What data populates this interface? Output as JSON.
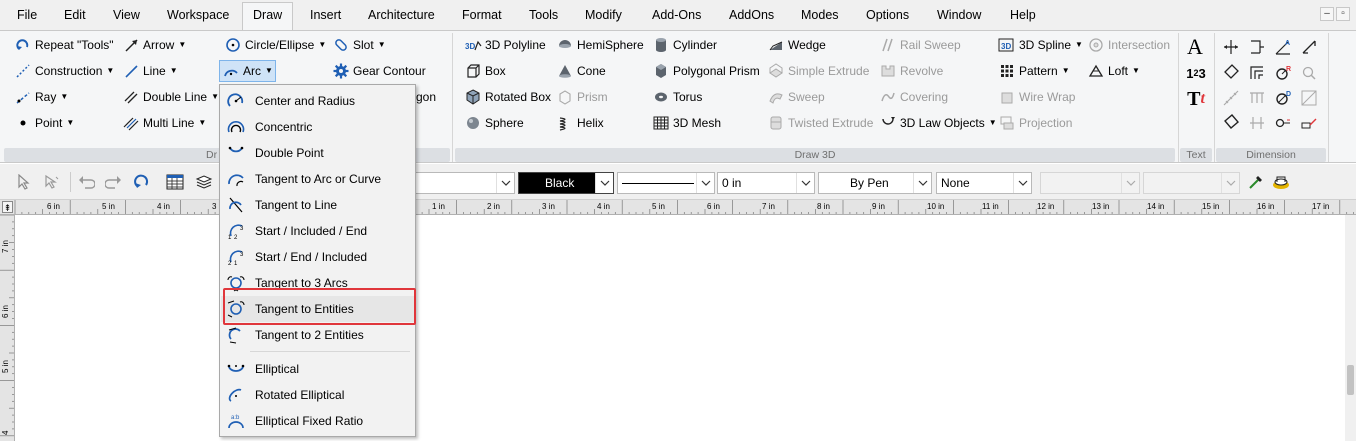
{
  "menubar": {
    "items": [
      "File",
      "Edit",
      "View",
      "Workspace",
      "Draw",
      "Insert",
      "Architecture",
      "Format",
      "Tools",
      "Modify",
      "Add-Ons",
      "AddOns",
      "Modes",
      "Options",
      "Window",
      "Help"
    ],
    "active": "Draw"
  },
  "ribbon": {
    "draw_col1": [
      "Repeat \"Tools\"",
      "Construction",
      "Ray",
      "Point"
    ],
    "draw_col2": [
      "Arrow",
      "Line",
      "Double Line",
      "Multi Line"
    ],
    "draw_col3": [
      "Circle/Ellipse",
      "Arc"
    ],
    "draw_col4": [
      "Slot",
      "Gear Contour",
      "ygon"
    ],
    "draw_group_label": "Dr",
    "d3_col1": [
      "3D Polyline",
      "Box",
      "Rotated Box",
      "Sphere"
    ],
    "d3_col2": [
      "HemiSphere",
      "Cone",
      "Prism",
      "Helix"
    ],
    "d3_col3": [
      "Cylinder",
      "Polygonal Prism",
      "Torus",
      "3D Mesh"
    ],
    "d3_col4": [
      "Wedge",
      "Simple Extrude",
      "Sweep",
      "Twisted Extrude"
    ],
    "d3_col5": [
      "Rail Sweep",
      "Revolve",
      "Covering",
      "3D Law Objects"
    ],
    "d3_col6": [
      "3D Spline",
      "Pattern",
      "Wire Wrap",
      "Projection"
    ],
    "d3_col7": [
      "Intersection",
      "Loft"
    ],
    "draw3d_group_label": "Draw 3D",
    "text_group_label": "Text",
    "dimension_group_label": "Dimension"
  },
  "toolbar": {
    "color": "Black",
    "line_width": "0 in",
    "pen": "By Pen",
    "fill": "None"
  },
  "ruler": {
    "top_labels": [
      "6 in",
      "5 in",
      "4 in",
      "3",
      "1 in",
      "2 in",
      "3 in",
      "4 in",
      "5 in",
      "6 in",
      "7 in",
      "8 in",
      "9 in",
      "10 in",
      "11 in",
      "12 in",
      "13 in",
      "14 in",
      "15 in",
      "16 in",
      "17 in"
    ],
    "left_labels": [
      "7 in",
      "6 in",
      "5 in",
      "4"
    ]
  },
  "arc_menu": {
    "items": [
      "Center and Radius",
      "Concentric",
      "Double Point",
      "Tangent to Arc or Curve",
      "Tangent to Line",
      "Start / Included / End",
      "Start / End / Included",
      "Tangent to 3 Arcs",
      "Tangent to Entities",
      "Tangent to 2 Entities",
      "Elliptical",
      "Rotated Elliptical",
      "Elliptical Fixed Ratio"
    ],
    "highlighted": "Tangent to Entities",
    "accent_color": "#e0363b"
  },
  "colors": {
    "icon_blue": "#1f5fb4",
    "highlight_red": "#e0363b"
  }
}
